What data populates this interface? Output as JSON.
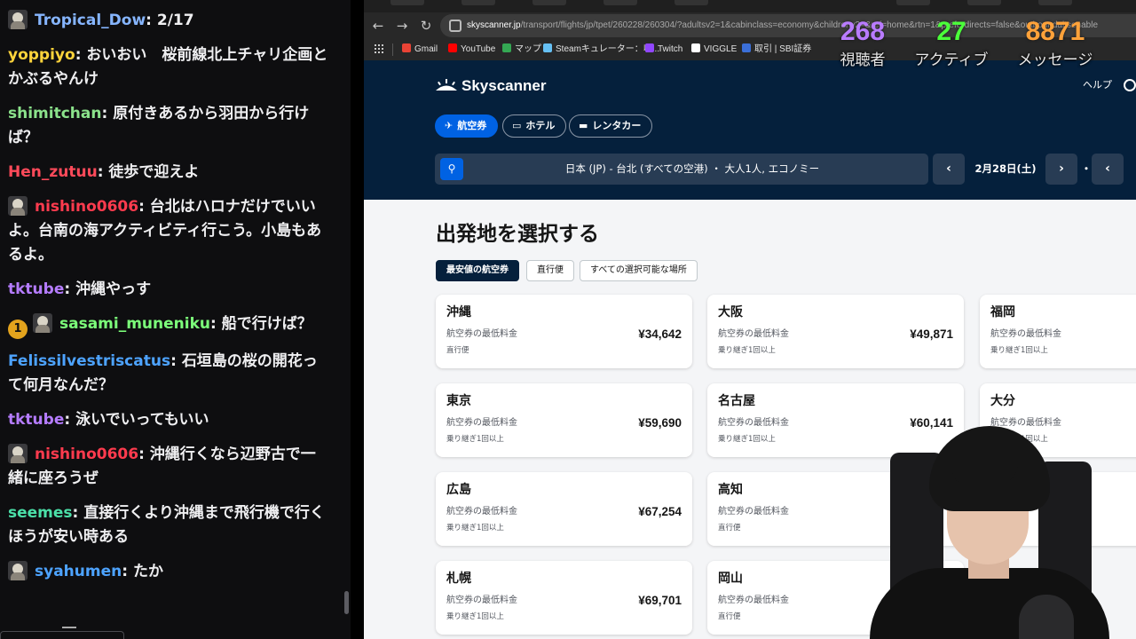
{
  "chat": {
    "messages": [
      {
        "avatar": true,
        "badge": "",
        "user": "Tropical_Dow",
        "color": "#86b5ff",
        "text": "2/17"
      },
      {
        "avatar": false,
        "badge": "",
        "user": "yoppiyo",
        "color": "#ffd43b",
        "text": "おいおい　桜前線北上チャリ企画とかぶるやんけ"
      },
      {
        "avatar": false,
        "badge": "",
        "user": "shimitchan",
        "color": "#8be28b",
        "text": "原付きあるから羽田から行けば？"
      },
      {
        "avatar": false,
        "badge": "",
        "user": "Hen_zutuu",
        "color": "#ff4a5a",
        "text": "徒歩で迎えよ"
      },
      {
        "avatar": true,
        "badge": "",
        "user": "nishino0606",
        "color": "#ff3b4e",
        "text": "台北はハロナだけでいいよ。台南の海アクティビティ行こう。小島もあるよ。"
      },
      {
        "avatar": false,
        "badge": "",
        "user": "tktube",
        "color": "#b57cff",
        "text": "沖縄やっす"
      },
      {
        "avatar": true,
        "badge": "1",
        "user": "sasami_muneniku",
        "color": "#7cff7a",
        "text": "船で行けば？"
      },
      {
        "avatar": false,
        "badge": "",
        "user": "Felissilvestriscatus",
        "color": "#4da3ff",
        "text": "石垣島の桜の開花って何月なんだ？"
      },
      {
        "avatar": false,
        "badge": "",
        "user": "tktube",
        "color": "#b57cff",
        "text": "泳いでいってもいい"
      },
      {
        "avatar": true,
        "badge": "",
        "user": "nishino0606",
        "color": "#ff3b4e",
        "text": "沖縄行くなら辺野古で一緒に座ろうぜ"
      },
      {
        "avatar": false,
        "badge": "",
        "user": "seemes",
        "color": "#4be0a8",
        "text": "直接行くより沖縄まで飛行機で行くほうが安い時ある"
      },
      {
        "avatar": true,
        "badge": "",
        "user": "syahumen",
        "color": "#4da3ff",
        "text": "たか"
      }
    ]
  },
  "overlay": {
    "viewers": {
      "value": "268",
      "label": "視聴者",
      "color": "#b97cff"
    },
    "active": {
      "value": "27",
      "label": "アクティブ",
      "color": "#4bff3a"
    },
    "messages": {
      "value": "8871",
      "label": "メッセージ",
      "color": "#ffa23a"
    }
  },
  "browser": {
    "url_host": "skyscanner.jp",
    "url_path": "/transport/flights/jp/tpet/260228/260304/?adultsv2=1&cabinclass=economy&childrenv2=&ref=home&rtn=1&preferdirects=false&outboundaltsenable",
    "bookmarks": [
      {
        "label": "Gmail",
        "color": "#ea4335"
      },
      {
        "label": "YouTube",
        "color": "#ff0000"
      },
      {
        "label": "マップ",
        "color": "#34a853"
      },
      {
        "label": "Steamキュレーター：収...",
        "color": "#66c0f4"
      },
      {
        "label": "Twitch",
        "color": "#9146ff"
      },
      {
        "label": "VIGGLE",
        "color": "#ffffff"
      },
      {
        "label": "取引 | SBI証券",
        "color": "#3b6fd8"
      }
    ]
  },
  "site": {
    "logo": "Skyscanner",
    "help": "ヘルプ",
    "tabs": [
      {
        "icon": "✈",
        "label": "航空券",
        "active": true
      },
      {
        "icon": "▭",
        "label": "ホテル",
        "active": false
      },
      {
        "icon": "▬",
        "label": "レンタカー",
        "active": false
      }
    ],
    "search_text": "日本 (JP) - 台北 (すべての空港) ・ 大人1人, エコノミー",
    "date": "2月28日(土)",
    "date_separator": "・",
    "title": "出発地を選択する",
    "filters": [
      {
        "label": "最安値の航空券",
        "active": true
      },
      {
        "label": "直行便",
        "active": false
      },
      {
        "label": "すべての選択可能な場所",
        "active": false
      }
    ],
    "price_caption": "航空券の最低料金",
    "cards": [
      {
        "city": "沖縄",
        "price": "¥34,642",
        "kind": "直行便"
      },
      {
        "city": "大阪",
        "price": "¥49,871",
        "kind": "乗り継ぎ1回以上"
      },
      {
        "city": "福岡",
        "price": "",
        "kind": "乗り継ぎ1回以上"
      },
      {
        "city": "東京",
        "price": "¥59,690",
        "kind": "乗り継ぎ1回以上"
      },
      {
        "city": "名古屋",
        "price": "¥60,141",
        "kind": "乗り継ぎ1回以上"
      },
      {
        "city": "大分",
        "price": "",
        "kind": "乗り継ぎ1回以上"
      },
      {
        "city": "広島",
        "price": "¥67,254",
        "kind": "乗り継ぎ1回以上"
      },
      {
        "city": "高知",
        "price": "",
        "kind": "直行便"
      },
      {
        "city": "",
        "price": "",
        "kind": ""
      },
      {
        "city": "札幌",
        "price": "¥69,701",
        "kind": "乗り継ぎ1回以上"
      },
      {
        "city": "岡山",
        "price": "",
        "kind": "直行便"
      }
    ]
  }
}
